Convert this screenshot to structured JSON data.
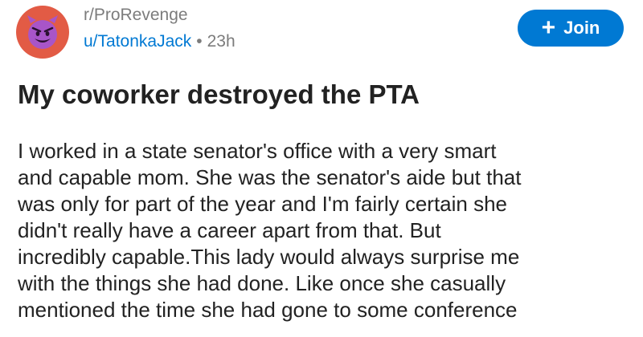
{
  "post": {
    "subreddit": "r/ProRevenge",
    "username": "u/TatonkaJack",
    "separator": "•",
    "time_ago": "23h",
    "join_label": "Join",
    "join_plus": "+",
    "title": "My coworker destroyed the PTA",
    "body_lines": [
      "I worked in a state senator's office with a very smart",
      "and capable mom. She was the senator's aide but that",
      "was only for part of the year and I'm fairly certain she",
      "didn't really have a career apart from that. But",
      "incredibly capable.This lady would always surprise me",
      "with the things she had done. Like once she casually",
      "mentioned the time she had gone to some conference"
    ]
  },
  "icons": {
    "avatar": "devil-face-icon",
    "join": "plus-icon"
  },
  "colors": {
    "avatar_bg": "#e25b45",
    "avatar_face": "#a855c8",
    "link_blue": "#0079d3",
    "meta_gray": "#7c7c7c"
  }
}
